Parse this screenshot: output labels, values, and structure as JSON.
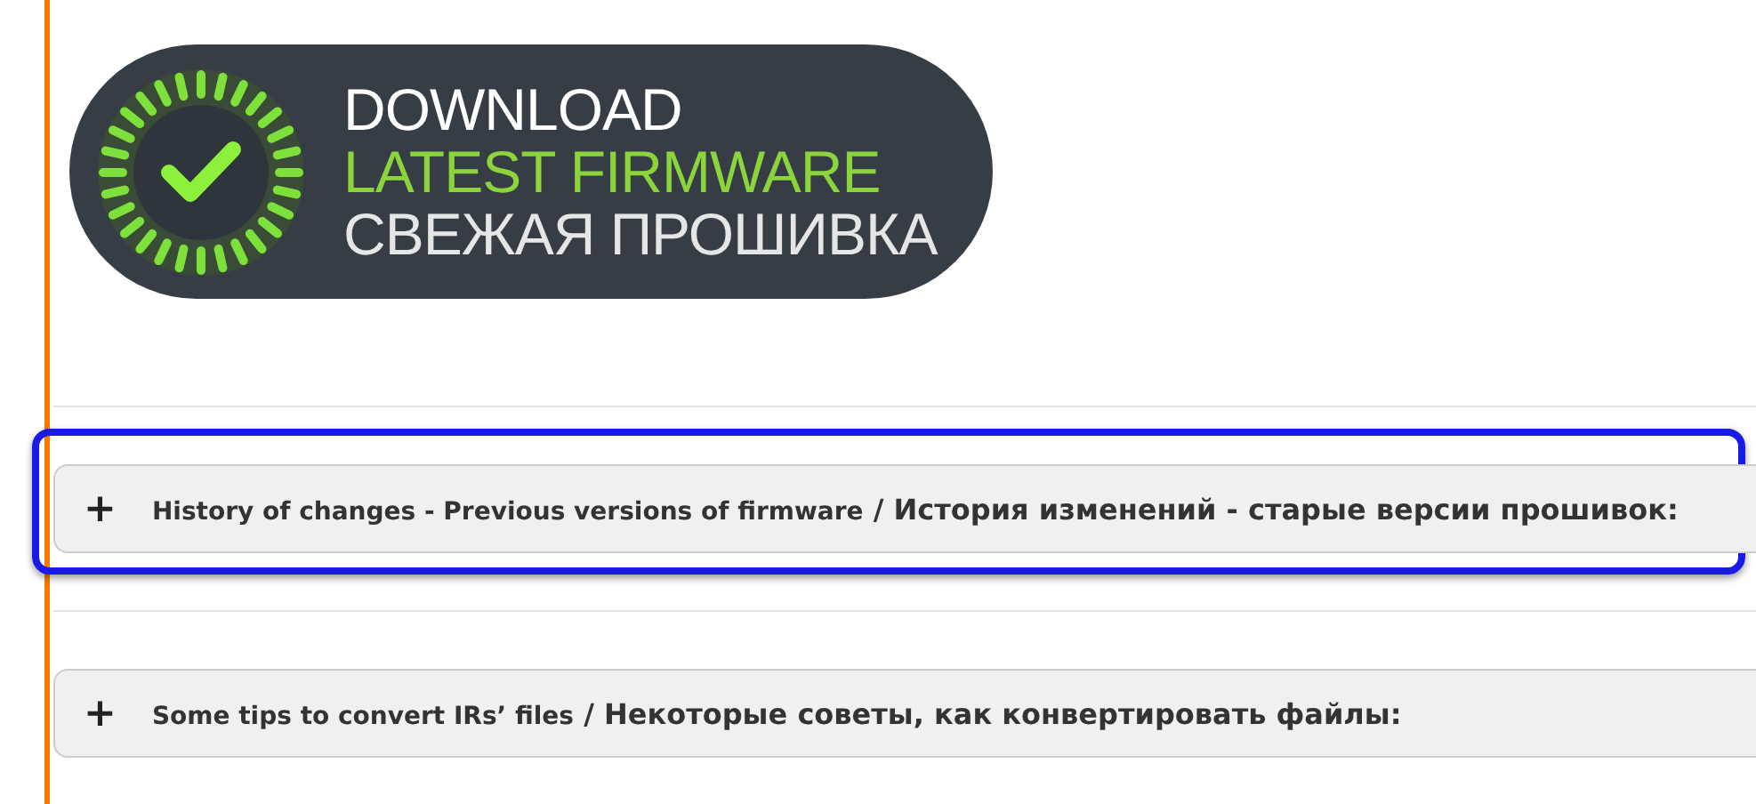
{
  "banner": {
    "lines": [
      {
        "text": "DOWNLOAD",
        "kind": "title"
      },
      {
        "text": "LATEST FIRMWARE",
        "kind": "accent"
      },
      {
        "text": "СВЕЖАЯ ПРОШИВКА",
        "kind": "plain"
      }
    ]
  },
  "sections": [
    {
      "icon": "+",
      "title_en": "History of changes - Previous versions of firmware",
      "title_ru": "/ История изменений - старые версии прошивок:",
      "expanded": false,
      "highlighted": true
    },
    {
      "icon": "+",
      "title_en": "Some tips to convert IRs’ files",
      "title_ru": "/ Некоторые советы, как конвертировать файлы:",
      "expanded": false,
      "highlighted": false
    }
  ]
}
